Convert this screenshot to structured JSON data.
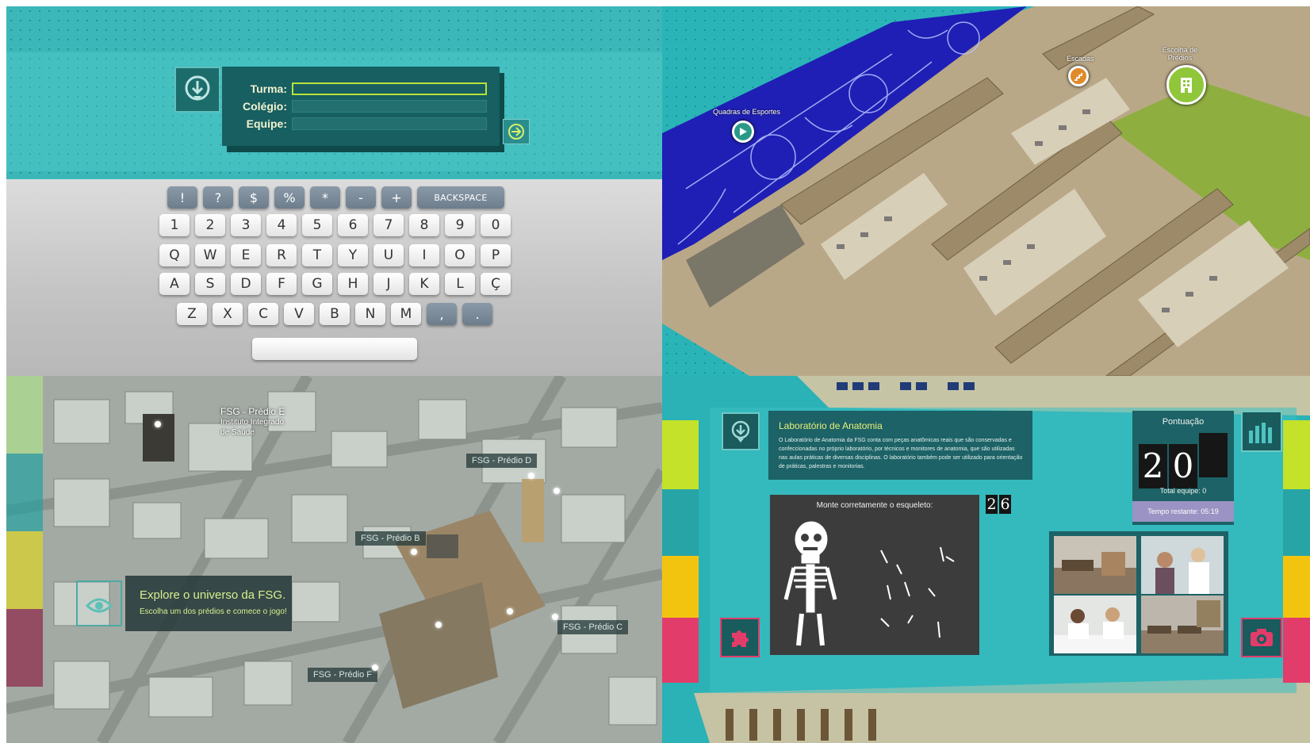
{
  "login": {
    "fields": [
      {
        "label": "Turma:"
      },
      {
        "label": "Colégio:"
      },
      {
        "label": "Equipe:"
      }
    ]
  },
  "keyboard": {
    "symbols": [
      "!",
      "?",
      "$",
      "%",
      "*",
      "-",
      "+"
    ],
    "backspace": "BACKSPACE",
    "numbers": [
      "1",
      "2",
      "3",
      "4",
      "5",
      "6",
      "7",
      "8",
      "9",
      "0"
    ],
    "row_q": [
      "Q",
      "W",
      "E",
      "R",
      "T",
      "Y",
      "U",
      "I",
      "O",
      "P"
    ],
    "row_a": [
      "A",
      "S",
      "D",
      "F",
      "G",
      "H",
      "J",
      "K",
      "L",
      "Ç"
    ],
    "row_z": [
      "Z",
      "X",
      "C",
      "V",
      "B",
      "N",
      "M"
    ],
    "row_z_dark": [
      ",",
      "."
    ]
  },
  "floor_map": {
    "labels": {
      "sports": "Quadras de Esportes",
      "stairs": "Escadas",
      "buildings": "Escolha de Prédios"
    }
  },
  "city_map": {
    "buildings": {
      "e_line1": "FSG - Prédio E",
      "e_line2": "Instituto Integrado",
      "e_line3": "de Saúde",
      "d": "FSG - Prédio D",
      "b": "FSG - Prédio B",
      "c": "FSG - Prédio C",
      "f": "FSG - Prédio F"
    },
    "explore": {
      "title": "Explore o universo da FSG.",
      "subtitle": "Escolha um dos prédios e comece o jogo!"
    }
  },
  "lab": {
    "title": "Laboratório de Anatomia",
    "description": "O Laboratório de Anatomia da FSG conta com peças anatômicas reais que são conservadas e confeccionadas no próprio laboratório, por técnicos e monitores de anatomia, que são utilizadas nas aulas práticas de diversas disciplinas. O laboratório também pode ser utilizado para orientação de práticas, palestras e monitorias.",
    "puzzle_prompt": "Monte corretamente o esqueleto:",
    "counter": [
      "2",
      "6"
    ],
    "score_title": "Pontuação",
    "score_digits": [
      "2",
      "0",
      ""
    ],
    "team_total": "Total equipe: 0",
    "time_left": "Tempo restante: 05:19"
  },
  "colors": {
    "teal": "#3bb7b9",
    "dark_teal": "#175f60",
    "lime": "#b8e23a",
    "yellow": "#f2c40f",
    "magenta": "#e23c6a",
    "lavender": "#9b93c3"
  }
}
